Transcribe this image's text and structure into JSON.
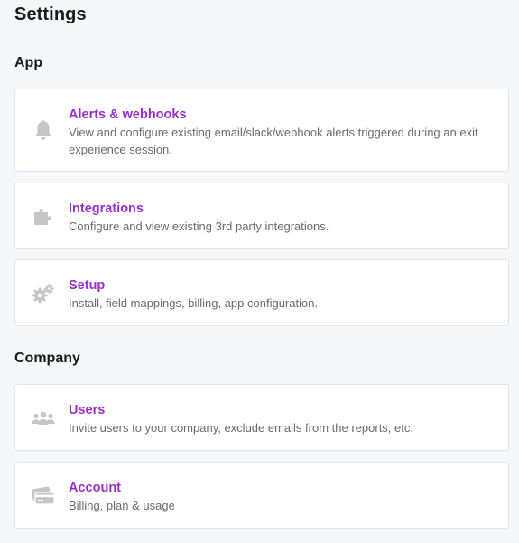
{
  "page": {
    "title": "Settings"
  },
  "sections": {
    "app": {
      "title": "App",
      "items": [
        {
          "title": "Alerts & webhooks",
          "description": "View and configure existing email/slack/webhook alerts triggered during an exit experience session.",
          "icon": "bell-icon"
        },
        {
          "title": "Integrations",
          "description": "Configure and view existing 3rd party integrations.",
          "icon": "puzzle-icon"
        },
        {
          "title": "Setup",
          "description": "Install, field mappings, billing, app configuration.",
          "icon": "gears-icon"
        }
      ]
    },
    "company": {
      "title": "Company",
      "items": [
        {
          "title": "Users",
          "description": "Invite users to your company, exclude emails from the reports, etc.",
          "icon": "users-icon"
        },
        {
          "title": "Account",
          "description": "Billing, plan & usage",
          "icon": "credit-card-icon"
        }
      ]
    }
  },
  "colors": {
    "accent": "#9b2fc9",
    "icon": "#c6c6c6",
    "background": "#f6f7fa"
  }
}
